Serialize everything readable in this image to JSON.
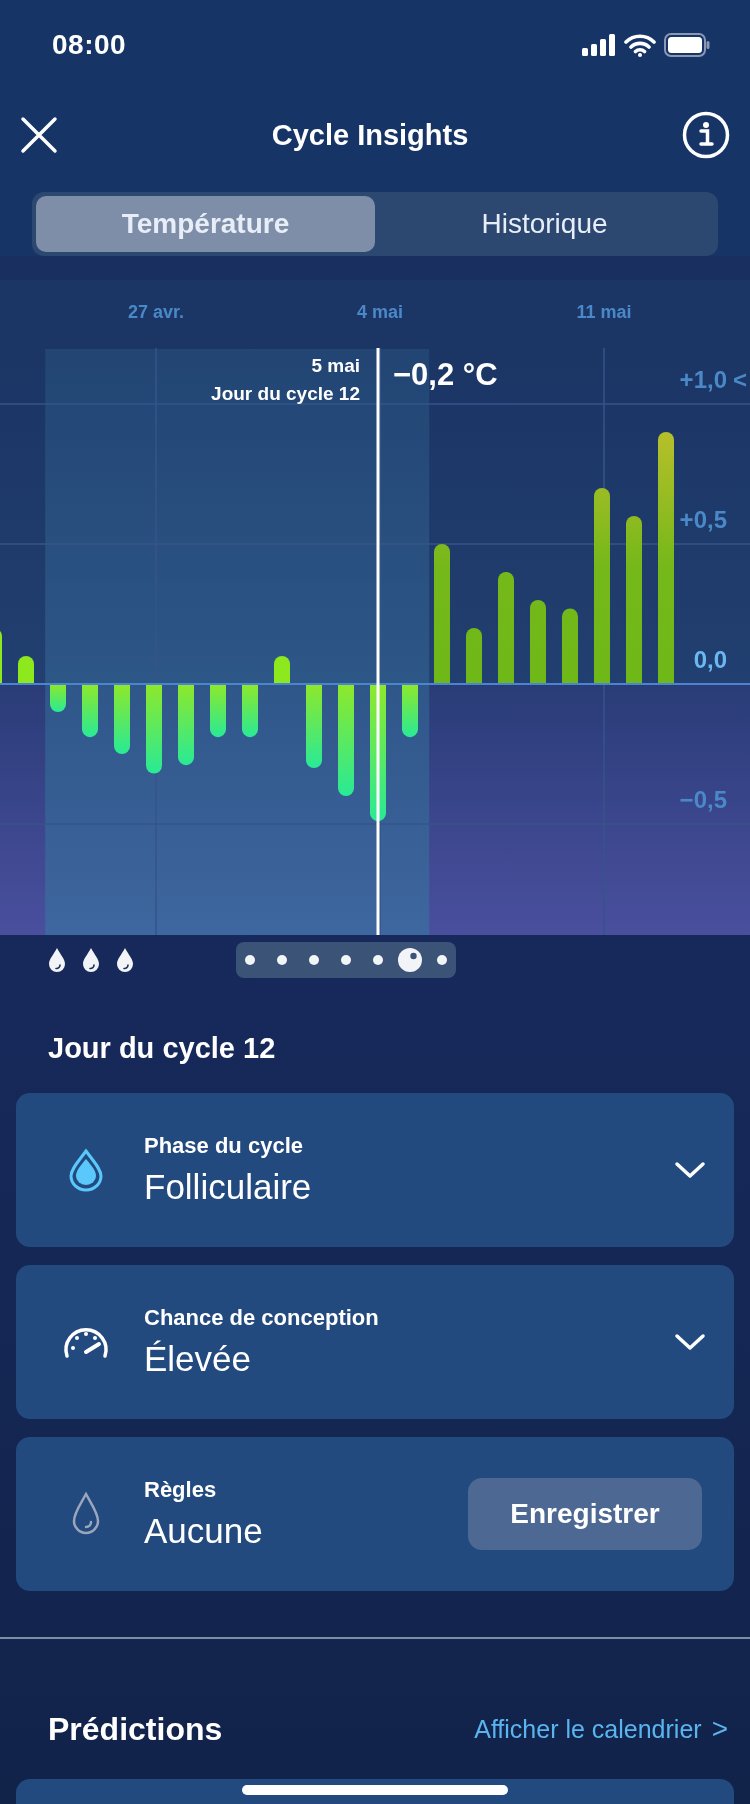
{
  "status_bar": {
    "time": "08:00"
  },
  "header": {
    "title": "Cycle Insights"
  },
  "tabs": [
    {
      "label": "Température",
      "selected": true
    },
    {
      "label": "Historique",
      "selected": false
    }
  ],
  "chart": {
    "scroll_hint": "<",
    "selection": {
      "date": "5 mai",
      "cycle_day": "Jour du cycle 12",
      "value": "−0,2 °C"
    },
    "chart_data": {
      "type": "bar",
      "categories": [
        null,
        null,
        null,
        null,
        null,
        "27 avr.",
        null,
        null,
        null,
        null,
        null,
        null,
        "4 mai",
        null,
        null,
        null,
        null,
        null,
        null,
        "11 mai",
        null,
        null
      ],
      "values": [
        0.2,
        0.1,
        -0.1,
        -0.19,
        -0.25,
        -0.32,
        -0.29,
        -0.19,
        -0.19,
        0.1,
        -0.3,
        -0.4,
        -0.49,
        -0.19,
        0.5,
        0.2,
        0.4,
        0.3,
        0.27,
        0.7,
        0.6,
        0.9
      ],
      "yticks": [
        {
          "value": 1,
          "label": "+1,0"
        },
        {
          "value": 0.5,
          "label": "+0,5"
        },
        {
          "value": 0,
          "label": "0,0"
        },
        {
          "value": -0.5,
          "label": "−0,5"
        }
      ],
      "ylim": [
        -0.9,
        1.2
      ],
      "grid": true,
      "ref_lines": [
        {
          "axis": "y",
          "value": 0
        }
      ]
    }
  },
  "day_markers": [
    {
      "selected": false
    },
    {
      "selected": false
    },
    {
      "selected": false
    },
    {
      "selected": false
    },
    {
      "selected": false
    },
    {
      "selected": true
    },
    {
      "selected": false
    }
  ],
  "day_title": "Jour du cycle 12",
  "cards": [
    {
      "kind": "dropdown",
      "label": "Phase du cycle",
      "value": "Folliculaire",
      "expanded": false
    },
    {
      "kind": "dropdown",
      "label": "Chance de conception",
      "value": "Élevée",
      "expanded": false
    },
    {
      "kind": "button",
      "label": "Règles",
      "value": "Aucune",
      "button": "Enregistrer"
    }
  ],
  "predictions": {
    "title": "Prédictions",
    "link": "Afficher le calendrier",
    "link_icon": ">"
  }
}
